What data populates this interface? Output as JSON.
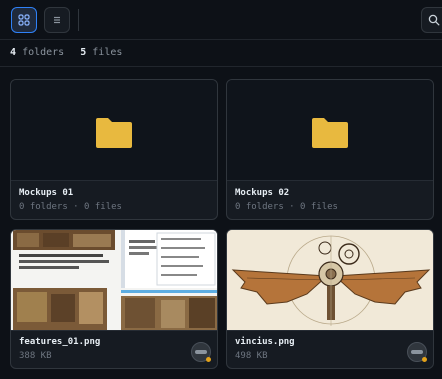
{
  "toolbar": {
    "view_grid_icon": "grid-icon",
    "view_list_icon": "list-icon",
    "search_icon": "search-icon",
    "accent_color": "#2f81f7"
  },
  "summary": {
    "folders_count": "4",
    "folders_label": "folders",
    "files_count": "5",
    "files_label": "files"
  },
  "folders": [
    {
      "name": "Mockups 01",
      "meta": "0 folders · 0 files",
      "icon": "folder-icon",
      "color": "#e8b93f"
    },
    {
      "name": "Mockups 02",
      "meta": "0 folders · 0 files",
      "icon": "folder-icon",
      "color": "#e8b93f"
    }
  ],
  "files": [
    {
      "name": "features_01.png",
      "size": "388 KB",
      "status_color": "#e3a21a"
    },
    {
      "name": "vincius.png",
      "size": "498 KB",
      "status_color": "#e3a21a"
    }
  ]
}
